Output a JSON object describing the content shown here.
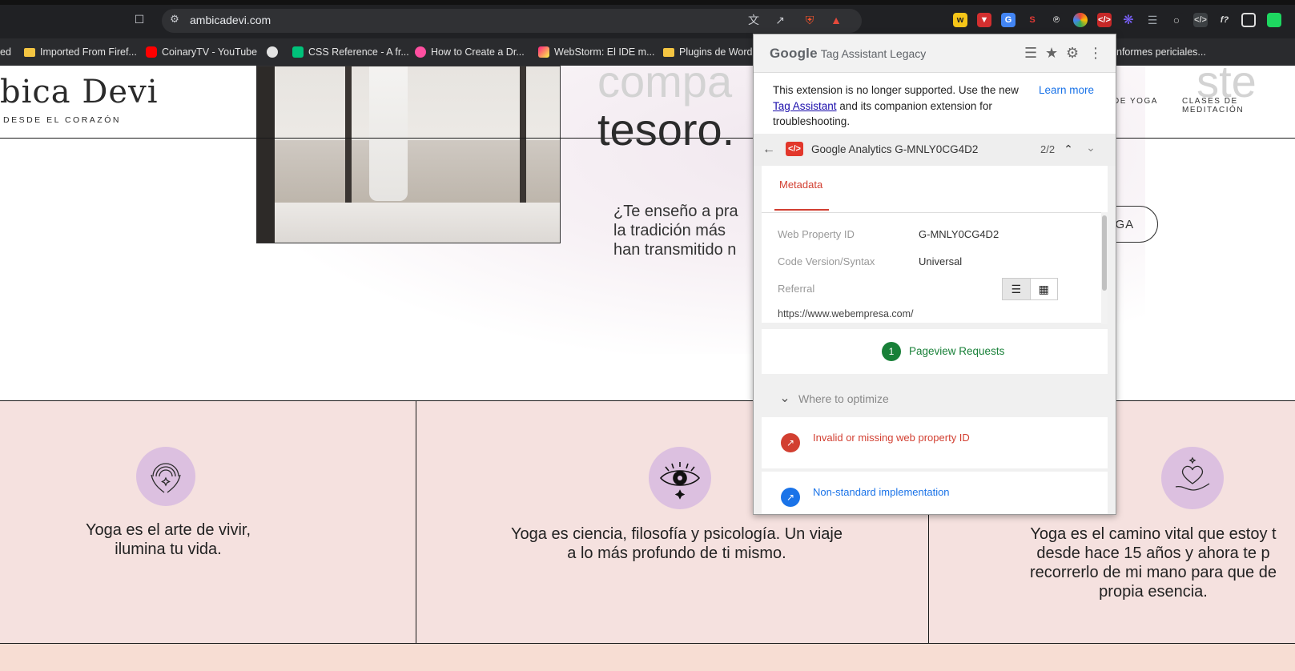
{
  "browser": {
    "url": "ambicadevi.com",
    "bookmarks": [
      "ed",
      "Imported From Firef...",
      "CoinaryTV - YouTube",
      "CSS Reference - A fr...",
      "How to Create a Dr...",
      "WebStorm: El IDE m...",
      "Plugins de WordP",
      "nformes periciales..."
    ]
  },
  "site": {
    "logo": "bica Devi",
    "logo_sub": "DESDE EL CORAZÓN",
    "nav": [
      "DE YOGA",
      "CLASES DE MEDITACIÓN"
    ],
    "hero_title_line1_start": "compa",
    "hero_title_line1_end": "ste",
    "hero_title_line2": "tesoro.",
    "hero_text": [
      "¿Te enseño a pra",
      "la tradición más",
      "han transmitido n"
    ],
    "hero_button": "OGA",
    "features": [
      {
        "text": "Yoga es el arte de vivir,\nilumina tu vida."
      },
      {
        "text": "Yoga es ciencia, filosofía y psicología. Un viaje\na lo más profundo de ti mismo."
      },
      {
        "text": "Yoga es el camino vital que estoy t\ndesde hace 15 años y ahora te p\nrecorrerlo de mi mano para que de\npropia esencia."
      }
    ]
  },
  "popup": {
    "brand_google": "Google",
    "brand_title": "Tag Assistant Legacy",
    "notice_before": "This extension is no longer supported. Use the new ",
    "notice_link": "Tag Assistant",
    "notice_after": " and its companion extension for troubleshooting.",
    "learn_more": "Learn more",
    "tag_name": "Google Analytics G-MNLY0CG4D2",
    "tag_count": "2/2",
    "tab_label": "Metadata",
    "fields": [
      {
        "key": "Web Property ID",
        "value": "G-MNLY0CG4D2"
      },
      {
        "key": "Code Version/Syntax",
        "value": "Universal"
      },
      {
        "key": "Referral",
        "value": ""
      }
    ],
    "referral_url": "https://www.webempresa.com/",
    "pageview_count": "1",
    "pageview_label": "Pageview Requests",
    "optimize_label": "Where to optimize",
    "issues": [
      {
        "text": "Invalid or missing web property ID",
        "color": "#d23f31"
      },
      {
        "text": "Non-standard implementation",
        "color": "#1a73e8"
      }
    ]
  }
}
